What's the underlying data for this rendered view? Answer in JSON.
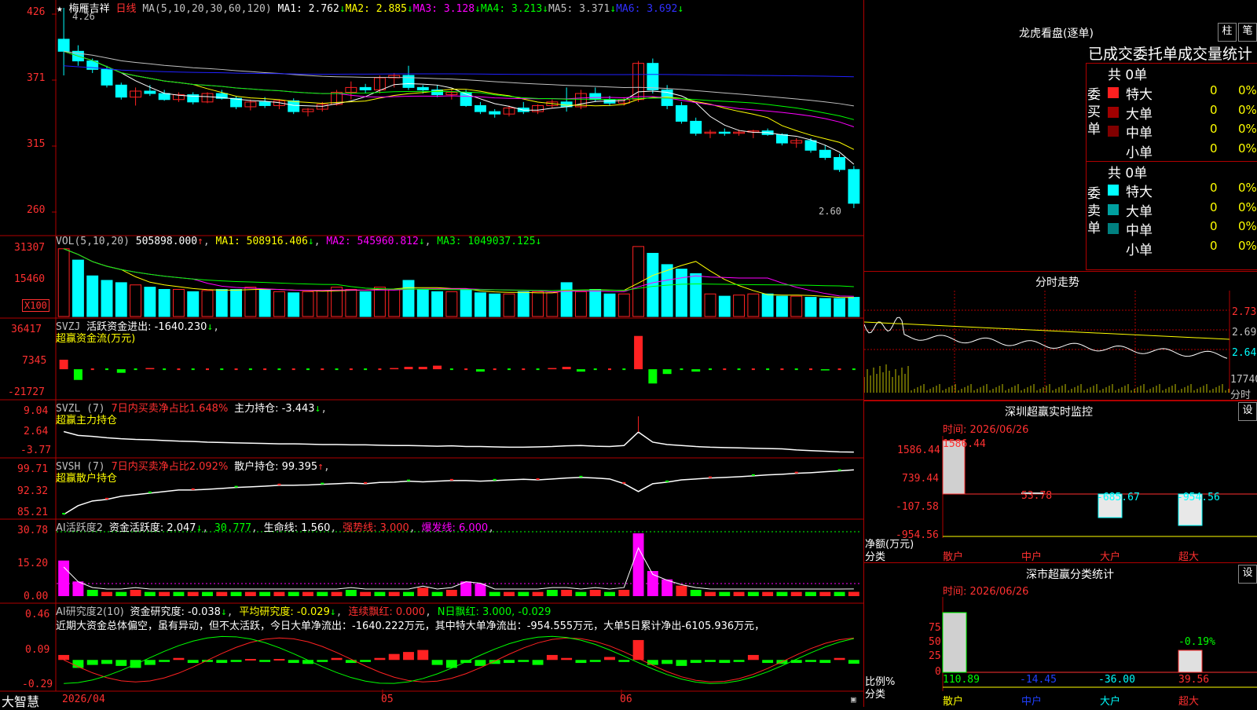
{
  "colors": {
    "up": "#ff2222",
    "down": "#00ffff",
    "ma1": "#ffffff",
    "ma2": "#ffff00",
    "ma3": "#ff00ff",
    "ma4": "#00ff00",
    "ma5": "#c0c0c0",
    "ma6": "#2020ff",
    "grid": "#b00000",
    "label": "#ff3030"
  },
  "header": {
    "stock_name": "梅雁吉祥",
    "period": "日线",
    "ma_label": "MA(5,10,20,30,60,120)",
    "ma1": "MA1: 2.762",
    "ma2": "MA2: 2.885",
    "ma3": "MA3: 3.128",
    "ma4": "MA4: 3.213",
    "ma5": "MA5: 3.371",
    "ma6": "MA6: 3.692",
    "high_mark": "4.26",
    "low_mark": "2.60"
  },
  "axes": {
    "price": [
      "426",
      "371",
      "315",
      "260"
    ],
    "vol": [
      "31307",
      "15460",
      "X100"
    ],
    "svzj": [
      "36417",
      "7345",
      "-21727"
    ],
    "svzl": [
      "9.04",
      "2.64",
      "-3.77"
    ],
    "svsh": [
      "99.71",
      "92.32",
      "85.21"
    ],
    "ai": [
      "30.78",
      "15.20",
      "0.00"
    ],
    "yj": [
      "0.46",
      "0.09",
      "-0.29"
    ]
  },
  "vol_header": {
    "label": "VOL(5,10,20)",
    "value": "505898.000",
    "ma1": "MA1: 508916.406",
    "ma2": "MA2: 545960.812",
    "ma3": "MA3: 1049037.125"
  },
  "svzj_header": {
    "label": "SVZJ",
    "title": "活跃资金进出: -1640.230",
    "sub": "超赢资金流(万元)"
  },
  "svzl_header": {
    "label": "SVZL (7)",
    "title": "7日内买卖净占比1.648%",
    "hold": "主力持仓: -3.443",
    "sub": "超赢主力持仓"
  },
  "svsh_header": {
    "label": "SVSH (7)",
    "title": "7日内买卖净占比2.092%",
    "hold": "散户持仓: 99.395",
    "sub": "超赢散户持仓"
  },
  "ai_header": {
    "label": "AI活跃度2",
    "active": "资金活跃度: 2.047",
    "v2": "30.777",
    "life": "生命线: 1.560",
    "strong": "强势线: 3.000",
    "burst": "爆发线: 6.000"
  },
  "yj_header": {
    "label": "AI研究度2(10)",
    "r1": "资金研究度: -0.038",
    "r2": "平均研究度: -0.029",
    "r3": "连续飘红: 0.000",
    "r4": "N日飘红: 3.000, -0.029",
    "note": "近期大资金总体偏空，虽有异动，但不太活跃，今日大单净流出：-1640.222万元，其中特大单净流出：-954.555万元，大单5日累计净出-6105.936万元，"
  },
  "footer": {
    "brand": "大智慧",
    "dates": [
      "2026/04",
      "05",
      "06"
    ]
  },
  "right": {
    "lhb_title": "龙虎看盘(逐单)",
    "btn_zhu": "柱",
    "btn_bi": "笔",
    "stat_title": "已成交委托单成交量统计",
    "buy": {
      "side": "委买单",
      "total": "共 0单",
      "rows": [
        {
          "name": "特大",
          "n": "0",
          "p": "0%"
        },
        {
          "name": "大单",
          "n": "0",
          "p": "0%"
        },
        {
          "name": "中单",
          "n": "0",
          "p": "0%"
        },
        {
          "name": "小单",
          "n": "0",
          "p": "0%"
        }
      ]
    },
    "sell": {
      "side": "委卖单",
      "total": "共 0单",
      "rows": [
        {
          "name": "特大",
          "n": "0",
          "p": "0%"
        },
        {
          "name": "大单",
          "n": "0",
          "p": "0%"
        },
        {
          "name": "中单",
          "n": "0",
          "p": "0%"
        },
        {
          "name": "小单",
          "n": "0",
          "p": "0%"
        }
      ]
    },
    "fs_title": "分时走势",
    "fs_axis": [
      "2.735",
      "2.690",
      "2.645"
    ],
    "fs_vol": "17740",
    "fs_label": "分时",
    "mon_title": "深圳超赢实时监控",
    "mon_btn": "设",
    "mon_time": "时间: 2026/06/26",
    "mon_axis": [
      "1586.44",
      "739.44",
      "-107.58",
      "-954.56"
    ],
    "mon_unit": "净额(万元)",
    "mon_cat_label": "分类",
    "mon_vals": [
      "1586.44",
      "53.78",
      "-685.67",
      "-954.56"
    ],
    "cats": [
      "散户",
      "中户",
      "大户",
      "超大"
    ],
    "cls_title": "深市超赢分类统计",
    "cls_btn": "设",
    "cls_time": "时间: 2026/06/26",
    "cls_axis": [
      "75",
      "50",
      "25",
      "0"
    ],
    "cls_unit": "比例%",
    "cls_cat_label": "分类",
    "cls_top": "-0.19%",
    "cls_vals": [
      "110.89",
      "-14.45",
      "-36.00",
      "39.56"
    ]
  },
  "chart_data": [
    {
      "type": "candlestick",
      "name": "daily",
      "ylim": [
        2.6,
        4.26
      ],
      "ohlc": [
        [
          4.0,
          4.26,
          3.7,
          3.9
        ],
        [
          3.9,
          3.95,
          3.78,
          3.82
        ],
        [
          3.82,
          3.84,
          3.72,
          3.75
        ],
        [
          3.75,
          3.78,
          3.6,
          3.62
        ],
        [
          3.62,
          3.64,
          3.5,
          3.52
        ],
        [
          3.52,
          3.6,
          3.45,
          3.57
        ],
        [
          3.57,
          3.62,
          3.53,
          3.55
        ],
        [
          3.55,
          3.58,
          3.49,
          3.5
        ],
        [
          3.5,
          3.56,
          3.48,
          3.54
        ],
        [
          3.54,
          3.56,
          3.46,
          3.48
        ],
        [
          3.48,
          3.56,
          3.47,
          3.55
        ],
        [
          3.55,
          3.58,
          3.5,
          3.51
        ],
        [
          3.51,
          3.53,
          3.42,
          3.44
        ],
        [
          3.44,
          3.5,
          3.41,
          3.48
        ],
        [
          3.48,
          3.52,
          3.43,
          3.45
        ],
        [
          3.45,
          3.5,
          3.42,
          3.49
        ],
        [
          3.49,
          3.51,
          3.38,
          3.4
        ],
        [
          3.4,
          3.43,
          3.36,
          3.42
        ],
        [
          3.42,
          3.48,
          3.4,
          3.46
        ],
        [
          3.46,
          3.58,
          3.45,
          3.56
        ],
        [
          3.56,
          3.65,
          3.5,
          3.6
        ],
        [
          3.6,
          3.63,
          3.55,
          3.58
        ],
        [
          3.58,
          3.7,
          3.55,
          3.68
        ],
        [
          3.68,
          3.72,
          3.6,
          3.7
        ],
        [
          3.7,
          3.78,
          3.58,
          3.6
        ],
        [
          3.6,
          3.62,
          3.55,
          3.58
        ],
        [
          3.58,
          3.62,
          3.52,
          3.54
        ],
        [
          3.54,
          3.58,
          3.5,
          3.56
        ],
        [
          3.56,
          3.58,
          3.44,
          3.45
        ],
        [
          3.45,
          3.48,
          3.38,
          3.4
        ],
        [
          3.4,
          3.42,
          3.35,
          3.38
        ],
        [
          3.38,
          3.45,
          3.36,
          3.43
        ],
        [
          3.43,
          3.48,
          3.38,
          3.4
        ],
        [
          3.4,
          3.46,
          3.38,
          3.45
        ],
        [
          3.45,
          3.5,
          3.43,
          3.48
        ],
        [
          3.48,
          3.6,
          3.4,
          3.44
        ],
        [
          3.44,
          3.58,
          3.42,
          3.55
        ],
        [
          3.55,
          3.6,
          3.48,
          3.5
        ],
        [
          3.5,
          3.53,
          3.45,
          3.47
        ],
        [
          3.47,
          3.52,
          3.45,
          3.5
        ],
        [
          3.5,
          3.82,
          3.48,
          3.8
        ],
        [
          3.8,
          3.84,
          3.55,
          3.58
        ],
        [
          3.58,
          3.62,
          3.42,
          3.45
        ],
        [
          3.45,
          3.48,
          3.3,
          3.32
        ],
        [
          3.32,
          3.35,
          3.2,
          3.22
        ],
        [
          3.22,
          3.25,
          3.18,
          3.23
        ],
        [
          3.23,
          3.26,
          3.2,
          3.22
        ],
        [
          3.22,
          3.25,
          3.2,
          3.23
        ],
        [
          3.23,
          3.25,
          3.18,
          3.24
        ],
        [
          3.24,
          3.26,
          3.2,
          3.21
        ],
        [
          3.21,
          3.22,
          3.12,
          3.14
        ],
        [
          3.14,
          3.18,
          3.1,
          3.16
        ],
        [
          3.16,
          3.18,
          3.06,
          3.08
        ],
        [
          3.08,
          3.12,
          3.0,
          3.02
        ],
        [
          3.02,
          3.05,
          2.9,
          2.92
        ],
        [
          2.92,
          2.95,
          2.6,
          2.64
        ]
      ]
    },
    {
      "type": "bar",
      "name": "volume_x100",
      "ylim": [
        0,
        31307
      ],
      "values": [
        30000,
        25000,
        18000,
        16000,
        15000,
        14000,
        13000,
        12000,
        12000,
        11000,
        11500,
        12000,
        12000,
        13000,
        12000,
        11000,
        10500,
        11000,
        11500,
        13000,
        12000,
        11000,
        13000,
        12000,
        16000,
        12000,
        11000,
        11000,
        12000,
        10500,
        10000,
        10000,
        11000,
        11000,
        10500,
        15000,
        11000,
        12000,
        10000,
        10000,
        31000,
        28000,
        23000,
        21000,
        19000,
        10000,
        9000,
        9500,
        10000,
        10000,
        9000,
        9000,
        8500,
        8000,
        8000,
        8500
      ],
      "up": [
        1,
        0,
        0,
        0,
        0,
        1,
        0,
        0,
        1,
        0,
        1,
        0,
        0,
        1,
        0,
        1,
        0,
        1,
        1,
        1,
        1,
        0,
        1,
        1,
        0,
        0,
        0,
        1,
        0,
        0,
        0,
        1,
        0,
        1,
        1,
        0,
        1,
        0,
        0,
        1,
        1,
        0,
        0,
        0,
        0,
        1,
        0,
        1,
        1,
        0,
        0,
        1,
        0,
        0,
        0,
        0
      ]
    },
    {
      "type": "bar",
      "name": "svzj",
      "ylim": [
        -21727,
        36417
      ],
      "values": [
        8000,
        -9000,
        0,
        0,
        -3000,
        0,
        1000,
        0,
        0,
        0,
        0,
        0,
        0,
        0,
        0,
        0,
        0,
        0,
        0,
        0,
        0,
        0,
        0,
        1000,
        2000,
        2000,
        3000,
        0,
        0,
        -2000,
        0,
        0,
        0,
        0,
        1000,
        2000,
        -2000,
        0,
        0,
        0,
        28000,
        -12000,
        -4000,
        0,
        -2000,
        0,
        0,
        0,
        0,
        0,
        0,
        0,
        0,
        -1000,
        0,
        0
      ]
    },
    {
      "type": "line",
      "name": "svzl",
      "ylim": [
        -3.77,
        9.04
      ],
      "values": [
        2.64,
        1.5,
        1.2,
        0.8,
        0.5,
        0.3,
        0.2,
        0.0,
        -0.2,
        -0.3,
        -0.5,
        -0.6,
        -0.7,
        -0.8,
        -0.9,
        -1.0,
        -1.0,
        -1.1,
        -1.2,
        -1.2,
        -1.3,
        -1.3,
        -1.4,
        -1.5,
        -1.5,
        -1.6,
        -1.7,
        -1.6,
        -1.8,
        -1.8,
        -1.9,
        -2.0,
        -2.0,
        -1.9,
        -1.8,
        -1.6,
        -1.5,
        -1.7,
        -1.8,
        -1.5,
        2.5,
        -0.5,
        -1.2,
        -1.5,
        -1.8,
        -2.0,
        -2.1,
        -2.2,
        -2.3,
        -2.4,
        -2.5,
        -2.8,
        -3.0,
        -3.2,
        -3.4,
        -3.44
      ]
    },
    {
      "type": "line",
      "name": "svsh",
      "ylim": [
        85.21,
        99.71
      ],
      "values": [
        85.21,
        88,
        89.5,
        90,
        91,
        91.5,
        92,
        92.5,
        93,
        93,
        93.2,
        93.5,
        93.8,
        94,
        94.2,
        94.5,
        94.5,
        94.6,
        94.8,
        95,
        95.2,
        95,
        95.4,
        95.5,
        95.8,
        95.6,
        95.8,
        96,
        96,
        95.8,
        96,
        96.2,
        96.4,
        96.2,
        96.5,
        96.8,
        97,
        96.8,
        96.5,
        95,
        92.5,
        95,
        95.5,
        96.2,
        96.5,
        96.8,
        97,
        97.2,
        97.5,
        97.8,
        98,
        98.3,
        98.5,
        98.8,
        99.1,
        99.4
      ]
    },
    {
      "type": "bar",
      "name": "ai_active",
      "ylim": [
        0,
        30.78
      ],
      "values": [
        17,
        7,
        3,
        2,
        2,
        3,
        2,
        2,
        2,
        2,
        2,
        2,
        2,
        2,
        2,
        2,
        2,
        2,
        2,
        2,
        3,
        2,
        2,
        2,
        2,
        4,
        2,
        3,
        7,
        6,
        2,
        2,
        2,
        2,
        3,
        3,
        2,
        3,
        2,
        3,
        30,
        12,
        8,
        5,
        3,
        2,
        2,
        2,
        2,
        2,
        2,
        2,
        2,
        2,
        2,
        2.047
      ]
    },
    {
      "type": "bar",
      "name": "ai_research",
      "ylim": [
        -0.29,
        0.46
      ],
      "values": [
        0.05,
        -0.08,
        -0.05,
        -0.04,
        -0.06,
        -0.08,
        -0.05,
        -0.02,
        0.02,
        -0.03,
        -0.02,
        -0.03,
        -0.02,
        0.01,
        -0.02,
        0.01,
        -0.03,
        -0.04,
        -0.02,
        0.02,
        -0.03,
        -0.02,
        0.02,
        0.06,
        0.08,
        0.1,
        -0.05,
        -0.08,
        -0.03,
        -0.06,
        -0.04,
        -0.03,
        -0.02,
        -0.05,
        0.05,
        0.02,
        -0.03,
        -0.02,
        0.03,
        -0.02,
        0.2,
        -0.05,
        -0.04,
        -0.06,
        -0.03,
        -0.02,
        -0.03,
        -0.02,
        0.05,
        -0.03,
        -0.04,
        -0.03,
        -0.02,
        -0.03,
        0.02,
        -0.038
      ]
    }
  ]
}
